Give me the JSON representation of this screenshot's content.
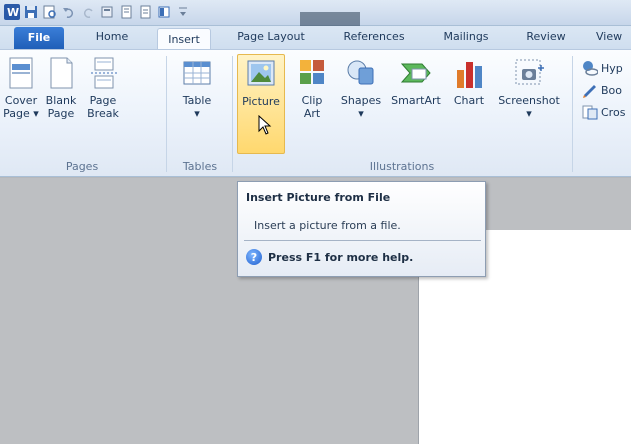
{
  "tabs": [
    {
      "label": "File"
    },
    {
      "label": "Home"
    },
    {
      "label": "Insert"
    },
    {
      "label": "Page Layout"
    },
    {
      "label": "References"
    },
    {
      "label": "Mailings"
    },
    {
      "label": "Review"
    },
    {
      "label": "View"
    }
  ],
  "ribbon": {
    "pages": {
      "label": "Pages",
      "cover": "Cover\nPage ▾",
      "blank": "Blank\nPage",
      "break": "Page\nBreak"
    },
    "tables": {
      "label": "Tables",
      "table": "Table\n▾"
    },
    "illustrations": {
      "label": "Illustrations",
      "picture": "Picture",
      "clipart": "Clip\nArt",
      "shapes": "Shapes\n▾",
      "smartart": "SmartArt",
      "chart": "Chart",
      "screenshot": "Screenshot\n▾"
    },
    "links": {
      "hyperlink": "Hyp",
      "bookmark": "Boo",
      "crossref": "Cros"
    }
  },
  "tooltip": {
    "title": "Insert Picture from File",
    "description": "Insert a picture from a file.",
    "help": "Press F1 for more help."
  },
  "colors": {
    "accent": "#1f5fb8",
    "highlight": "#ffd86e"
  }
}
